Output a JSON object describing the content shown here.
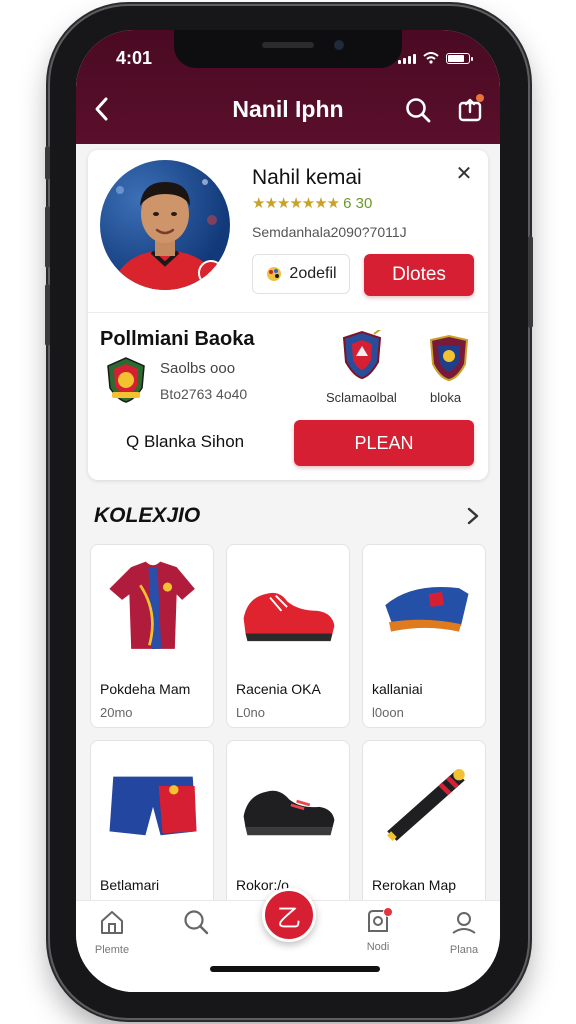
{
  "status_bar": {
    "time": "4:01"
  },
  "header": {
    "title": "Nanil Iphn",
    "back_icon": "chevron-left-icon",
    "search_icon": "search-icon",
    "share_icon": "share-icon"
  },
  "profile": {
    "name": "Nahil kemai",
    "rating_stars": "★★★★★★★",
    "rating_value": "6 30",
    "meta": "Semdanhala2090?7011J",
    "chip_label": "2odefil",
    "follow_label": "Dlotes",
    "colors": {
      "accent": "#d71f33",
      "header": "#4a0a22"
    }
  },
  "club": {
    "name": "Pollmiani Baoka",
    "line1": "Saolbs ooo",
    "line2": "Bto2763 4o40",
    "team_a_label": "Sclamaolbal",
    "team_b_label": "bloka",
    "coach": "Q Blanka Sihon",
    "plan_label": "PLEAN"
  },
  "collection": {
    "title": "KOLEXJIO",
    "items": [
      {
        "name": "Pokdeha Mam",
        "price": "20mo",
        "icon": "jersey-icon"
      },
      {
        "name": "Racenia OKA",
        "price": "L0no",
        "icon": "red-sneaker-icon"
      },
      {
        "name": "kallaniai",
        "price": "l0oon",
        "icon": "cap-icon"
      },
      {
        "name": "Betlamari",
        "price": "",
        "icon": "shorts-icon"
      },
      {
        "name": "Rokor:/o",
        "price": "",
        "icon": "black-shoe-icon"
      },
      {
        "name": "Rerokan Map",
        "price": "",
        "icon": "scarf-icon"
      }
    ]
  },
  "tabs": [
    {
      "label": "Plemte",
      "icon": "home-icon"
    },
    {
      "label": "",
      "icon": "search-icon"
    },
    {
      "label": "Nodi",
      "icon": "notification-icon"
    },
    {
      "label": "Plana",
      "icon": "profile-icon"
    }
  ],
  "fab": {
    "label": "乙"
  }
}
